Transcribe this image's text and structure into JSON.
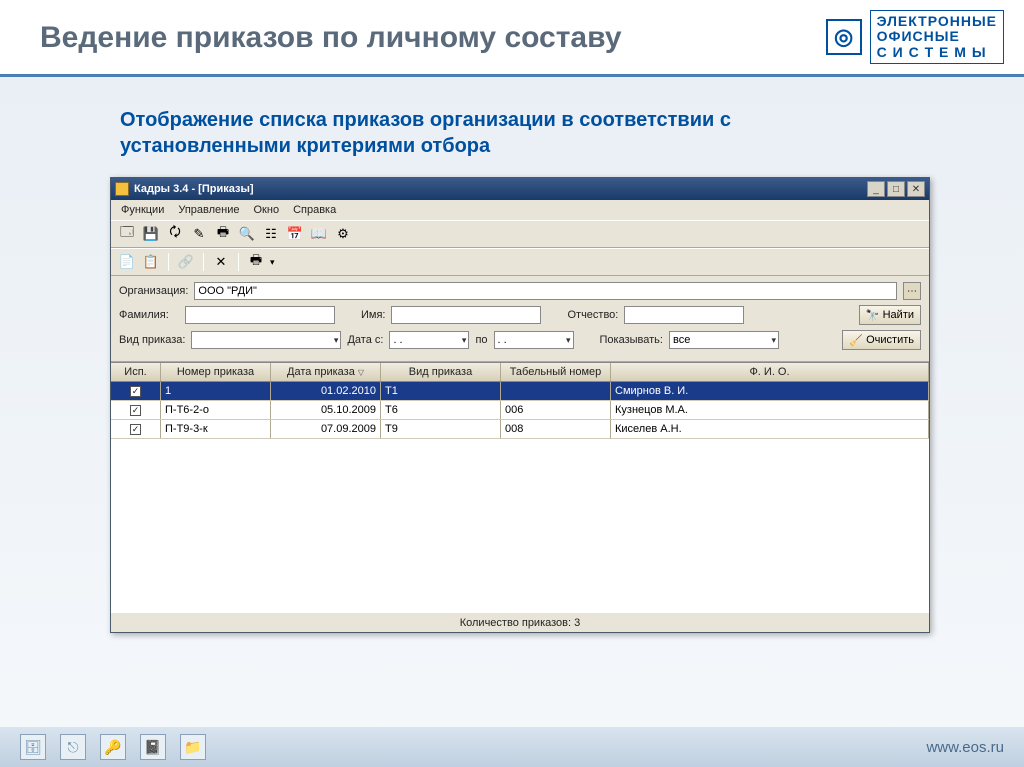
{
  "slide": {
    "title": "Ведение приказов по личному составу",
    "subtitle": "Отображение списка приказов организации в соответствии с установленными критериями отбора"
  },
  "brand": {
    "line1": "ЭЛЕКТРОННЫЕ",
    "line2": "ОФИСНЫЕ",
    "line3": "С И С Т Е М Ы"
  },
  "footer": {
    "url": "www.eos.ru"
  },
  "win": {
    "title": "Кадры 3.4 - [Приказы]",
    "menu": {
      "m0": "Функции",
      "m1": "Управление",
      "m2": "Окно",
      "m3": "Справка"
    },
    "labels": {
      "org": "Организация:",
      "lastname": "Фамилия:",
      "firstname": "Имя:",
      "middlename": "Отчество:",
      "find": "Найти",
      "ordertype": "Вид приказа:",
      "datefrom": "Дата с:",
      "dateto": "по",
      "show": "Показывать:",
      "clear": "Очистить"
    },
    "values": {
      "org": "ООО \"РДИ\"",
      "ordertype": "",
      "datefrom": ". .",
      "dateto": ". .",
      "show": "все"
    },
    "grid": {
      "headers": {
        "h0": "Исп.",
        "h1": "Номер приказа",
        "h2": "Дата приказа",
        "h3": "Вид приказа",
        "h4": "Табельный номер",
        "h5": "Ф. И. О."
      },
      "rows": [
        {
          "num": "1",
          "date": "01.02.2010",
          "type": "Т1",
          "tab": "",
          "fio": "Смирнов В. И."
        },
        {
          "num": "П-Т6-2-о",
          "date": "05.10.2009",
          "type": "Т6",
          "tab": "006",
          "fio": "Кузнецов М.А."
        },
        {
          "num": "П-Т9-3-к",
          "date": "07.09.2009",
          "type": "Т9",
          "tab": "008",
          "fio": "Киселев А.Н."
        }
      ]
    },
    "status": "Количество приказов: 3"
  }
}
